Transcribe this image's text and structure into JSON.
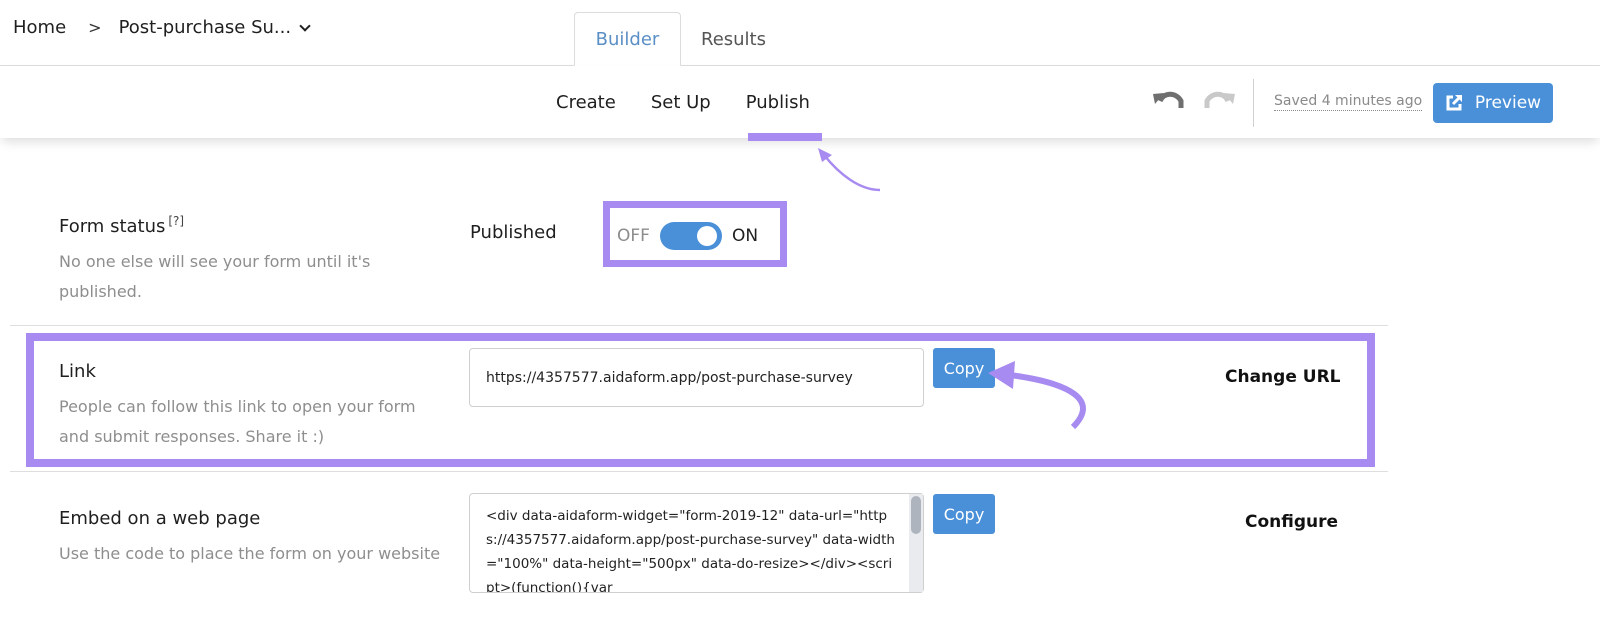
{
  "breadcrumb": {
    "home": "Home",
    "separator": ">",
    "current": "Post-purchase Su..."
  },
  "main_tabs": [
    {
      "label": "Builder",
      "active": true
    },
    {
      "label": "Results",
      "active": false
    }
  ],
  "sub_tabs": [
    {
      "label": "Create",
      "active": false
    },
    {
      "label": "Set Up",
      "active": false
    },
    {
      "label": "Publish",
      "active": true
    }
  ],
  "toolbar": {
    "undo_icon": "undo-icon",
    "redo_icon": "redo-icon",
    "saved_status": "Saved 4 minutes ago",
    "preview_label": "Preview",
    "preview_icon": "external-link-icon"
  },
  "form_status": {
    "title": "Form status",
    "help": "[?]",
    "description": "No one else will see your form until it's published.",
    "state_label": "Published",
    "toggle_off": "OFF",
    "toggle_on": "ON",
    "enabled": true
  },
  "link": {
    "title": "Link",
    "description": "People can follow this link to open your form and submit responses. Share it :)",
    "url": "https://4357577.aidaform.app/post-purchase-survey",
    "copy_label": "Copy",
    "change_url_label": "Change URL"
  },
  "embed": {
    "title": "Embed on a web page",
    "description": "Use the code to place the form on your website",
    "code": "<div data-aidaform-widget=\"form-2019-12\" data-url=\"https://4357577.aidaform.app/post-purchase-survey\" data-width=\"100%\" data-height=\"500px\" data-do-resize></div><script>(function(){var",
    "copy_label": "Copy",
    "configure_label": "Configure"
  },
  "colors": {
    "accent_blue": "#4a90d9",
    "highlight_purple": "#a78bf0",
    "active_tab_text": "#5a8fc5"
  }
}
